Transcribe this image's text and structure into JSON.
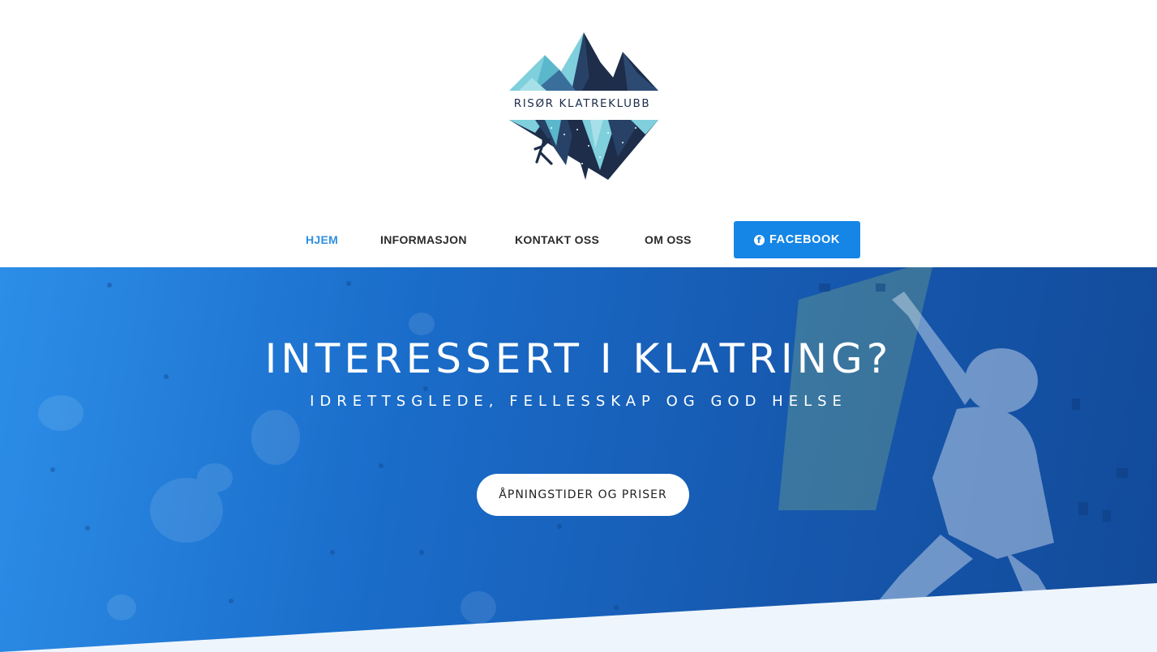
{
  "logo": {
    "text": "RISØR KLATREKLUBB"
  },
  "nav": {
    "items": [
      {
        "label": "HJEM",
        "active": true
      },
      {
        "label": "INFORMASJON",
        "active": false
      },
      {
        "label": "KONTAKT OSS",
        "active": false
      },
      {
        "label": "OM OSS",
        "active": false
      }
    ],
    "facebook_label": "FACEBOOK",
    "facebook_icon": "facebook-icon"
  },
  "hero": {
    "title": "INTERESSERT I KLATRING?",
    "subtitle": "IDRETTSGLEDE, FELLESSKAP OG GOD HELSE",
    "cta_label": "ÅPNINGSTIDER OG PRISER"
  },
  "colors": {
    "accent": "#2f8fe0",
    "facebook_blue": "#1585e6",
    "hero_blue": "#1a6cc9",
    "logo_navy": "#1d2d4a",
    "logo_light_blue": "#7fcfdc",
    "section_bg": "#eef5fc"
  }
}
